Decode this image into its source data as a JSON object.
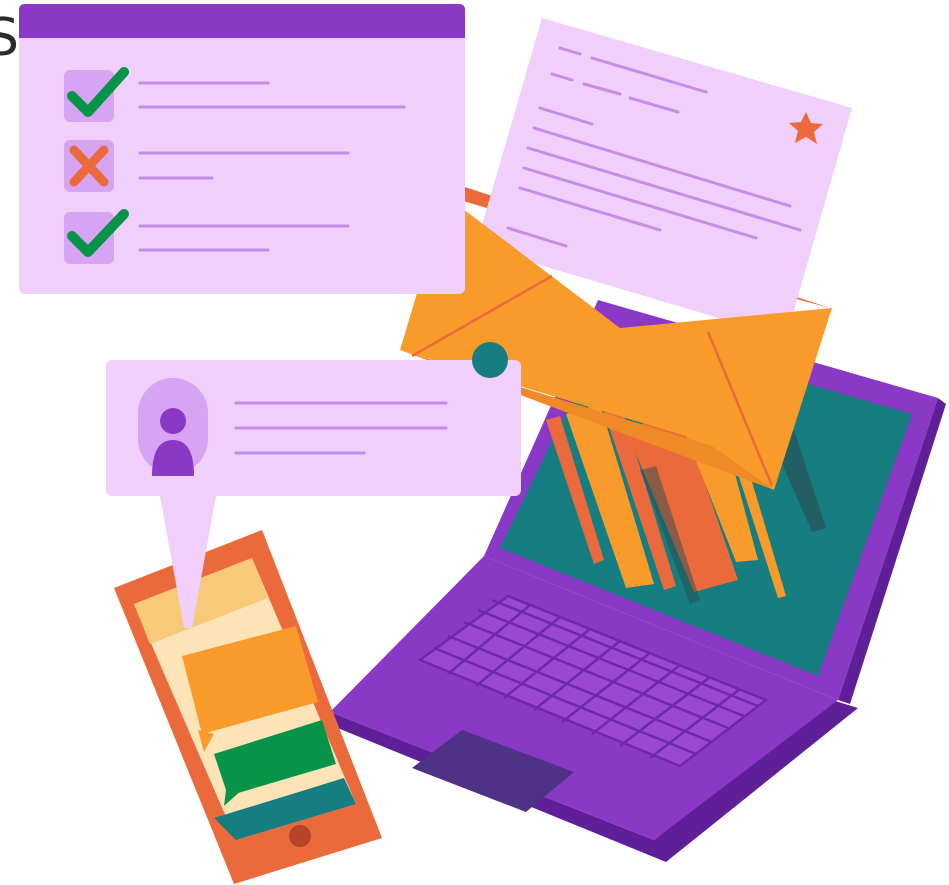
{
  "partial_text": "S",
  "colors": {
    "purple_dark": "#7b2fbe",
    "purple_light": "#f0cffb",
    "purple_line": "#c48ee8",
    "orange": "#f89b2a",
    "orange_red": "#eb6a3c",
    "teal": "#167d80",
    "green": "#089448",
    "phone_screen": "#fde3b8",
    "touchpad": "#4e3286"
  },
  "checklist": {
    "items": [
      {
        "status": "checked",
        "icon": "checkmark-icon"
      },
      {
        "status": "rejected",
        "icon": "cross-icon"
      },
      {
        "status": "checked",
        "icon": "checkmark-icon"
      }
    ]
  },
  "icons": [
    "user-avatar-icon",
    "star-icon",
    "envelope-icon",
    "smartphone-icon",
    "laptop-icon",
    "chat-bubble-icon"
  ]
}
